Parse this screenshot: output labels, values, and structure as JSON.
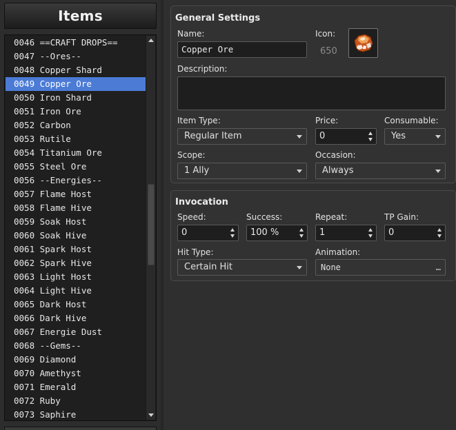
{
  "left_panel": {
    "title": "Items",
    "items": [
      {
        "label": "0046 ==CRAFT DROPS=="
      },
      {
        "label": "0047 --Ores--"
      },
      {
        "label": "0048 Copper Shard"
      },
      {
        "label": "0049 Copper Ore"
      },
      {
        "label": "0050 Iron Shard"
      },
      {
        "label": "0051 Iron Ore"
      },
      {
        "label": "0052 Carbon"
      },
      {
        "label": "0053 Rutile"
      },
      {
        "label": "0054 Titanium Ore"
      },
      {
        "label": "0055 Steel Ore"
      },
      {
        "label": "0056 --Energies--"
      },
      {
        "label": "0057 Flame Host"
      },
      {
        "label": "0058 Flame Hive"
      },
      {
        "label": "0059 Soak Host"
      },
      {
        "label": "0060 Soak Hive"
      },
      {
        "label": "0061 Spark Host"
      },
      {
        "label": "0062 Spark Hive"
      },
      {
        "label": "0063 Light Host"
      },
      {
        "label": "0064 Light Hive"
      },
      {
        "label": "0065 Dark Host"
      },
      {
        "label": "0066 Dark Hive"
      },
      {
        "label": "0067 Energie Dust"
      },
      {
        "label": "0068 --Gems--"
      },
      {
        "label": "0069 Diamond"
      },
      {
        "label": "0070 Amethyst"
      },
      {
        "label": "0071 Emerald"
      },
      {
        "label": "0072 Ruby"
      },
      {
        "label": "0073 Saphire"
      }
    ],
    "selected_index": 3
  },
  "general": {
    "title": "General Settings",
    "name_label": "Name:",
    "name_value": "Copper Ore",
    "icon_label": "Icon:",
    "icon_index": "650",
    "description_label": "Description:",
    "description_value": "",
    "item_type_label": "Item Type:",
    "item_type_value": "Regular Item",
    "price_label": "Price:",
    "price_value": "0",
    "consumable_label": "Consumable:",
    "consumable_value": "Yes",
    "scope_label": "Scope:",
    "scope_value": "1 Ally",
    "occasion_label": "Occasion:",
    "occasion_value": "Always"
  },
  "invocation": {
    "title": "Invocation",
    "speed_label": "Speed:",
    "speed_value": "0",
    "success_label": "Success:",
    "success_value": "100 %",
    "repeat_label": "Repeat:",
    "repeat_value": "1",
    "tp_gain_label": "TP Gain:",
    "tp_gain_value": "0",
    "hit_type_label": "Hit Type:",
    "hit_type_value": "Certain Hit",
    "animation_label": "Animation:",
    "animation_value": "None",
    "animation_button": "…"
  },
  "colors": {
    "selection": "#4c7bd6",
    "ore_primary": "#e07a2c"
  },
  "icons": {
    "item_icon": "copper-ore-icon"
  }
}
